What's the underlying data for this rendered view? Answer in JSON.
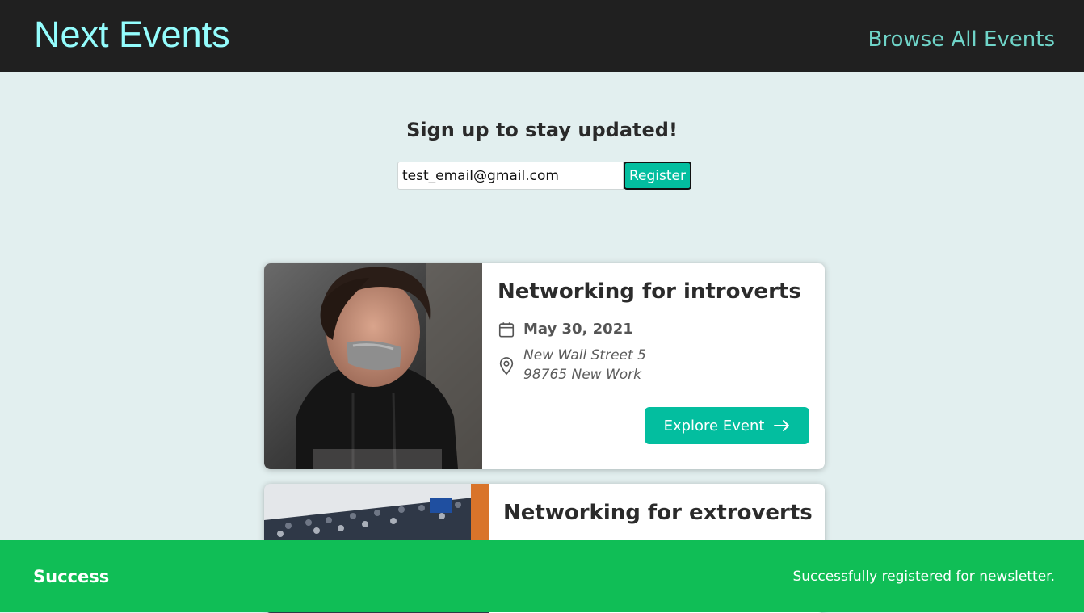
{
  "header": {
    "logo": "Next Events",
    "browse_link": "Browse All Events"
  },
  "newsletter": {
    "title": "Sign up to stay updated!",
    "email_value": "test_email@gmail.com",
    "register_label": "Register"
  },
  "events": [
    {
      "title": "Networking for introverts",
      "date": "May 30, 2021",
      "address_line1": "New Wall Street 5",
      "address_line2": "98765 New Work",
      "button_label": "Explore Event",
      "image": "person-with-taped-mouth-photo"
    },
    {
      "title": "Networking for extroverts",
      "image": "crowd-at-event-photo"
    }
  ],
  "notification": {
    "title": "Success",
    "message": "Successfully registered for newsletter.",
    "color": "#10be56"
  },
  "colors": {
    "accent": "#03be9f",
    "header_bg": "#202020",
    "logo": "#94fdfd",
    "page_bg": "#e2efef"
  }
}
